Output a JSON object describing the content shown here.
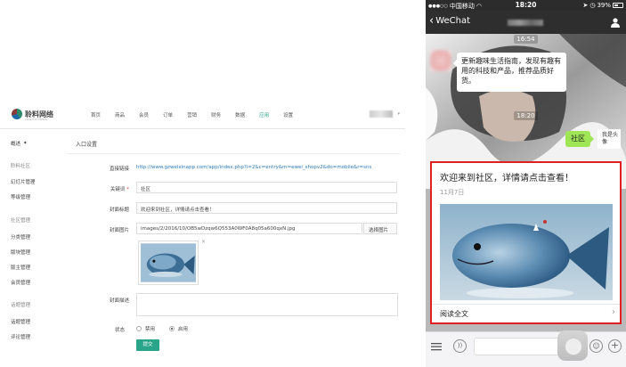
{
  "admin": {
    "logo": {
      "name": "聆料网络",
      "sub": "LINGXIAO MEDIA"
    },
    "nav": [
      "首页",
      "商品",
      "会员",
      "订单",
      "营销",
      "财务",
      "数据",
      "应用",
      "设置"
    ],
    "nav_active_index": 7,
    "sidebar": {
      "overview": "概述",
      "sections": [
        {
          "title": "聆料社区",
          "items": [
            "幻灯片管理",
            "等级管理"
          ]
        },
        {
          "title": "社区管理",
          "items": [
            "分类管理",
            "版块管理",
            "版主管理",
            "会员管理"
          ]
        },
        {
          "title": "话题管理",
          "items": [
            "话题管理",
            "评论管理"
          ]
        }
      ]
    },
    "breadcrumb": "入口设置",
    "form": {
      "direct_link_label": "直接链接",
      "direct_link_value": "http://www.gzweixinapp.com/app/index.php?i=2&c=entry&m=ewei_shopv2&do=mobile&r=sns",
      "keyword_label": "关键词",
      "keyword_value": "社区",
      "cover_title_label": "封面标题",
      "cover_title_value": "欢迎来到社区，详情请点击查看！",
      "cover_image_label": "封面图片",
      "cover_image_value": "images/2/2016/10/OB5wDzqw6Q553A0WF0A8q05a600qxN.jpg",
      "choose_image_button": "选择图片",
      "remove_icon": "×",
      "cover_desc_label": "封面描述",
      "status_label": "状态",
      "status_options": [
        "禁用",
        "启用"
      ],
      "status_selected": "启用",
      "submit_button": "提交"
    }
  },
  "phone": {
    "status_bar": {
      "carrier": "中国移动",
      "time": "18:20",
      "battery": "39%"
    },
    "nav": {
      "back_label": "WeChat"
    },
    "timestamps": [
      "16:54",
      "18:20"
    ],
    "incoming_message": "更新趣味生活指南，发现有趣有用的科技和产品，推荐品质好货。",
    "outgoing_message": "社区",
    "my_avatar_text": "我是头像",
    "card": {
      "title": "欢迎来到社区，详情请点击查看！",
      "date": "11月7日",
      "read_more": "阅读全文"
    }
  },
  "colors": {
    "accent": "#2aa58a",
    "highlight_border": "#e02020",
    "wechat_green": "#9fe657"
  },
  "icons": [
    "back-chevron-icon",
    "person-icon",
    "menu-icon",
    "voice-icon",
    "emoji-icon",
    "plus-icon",
    "chevron-right-icon",
    "remove-icon",
    "gear-icon"
  ]
}
